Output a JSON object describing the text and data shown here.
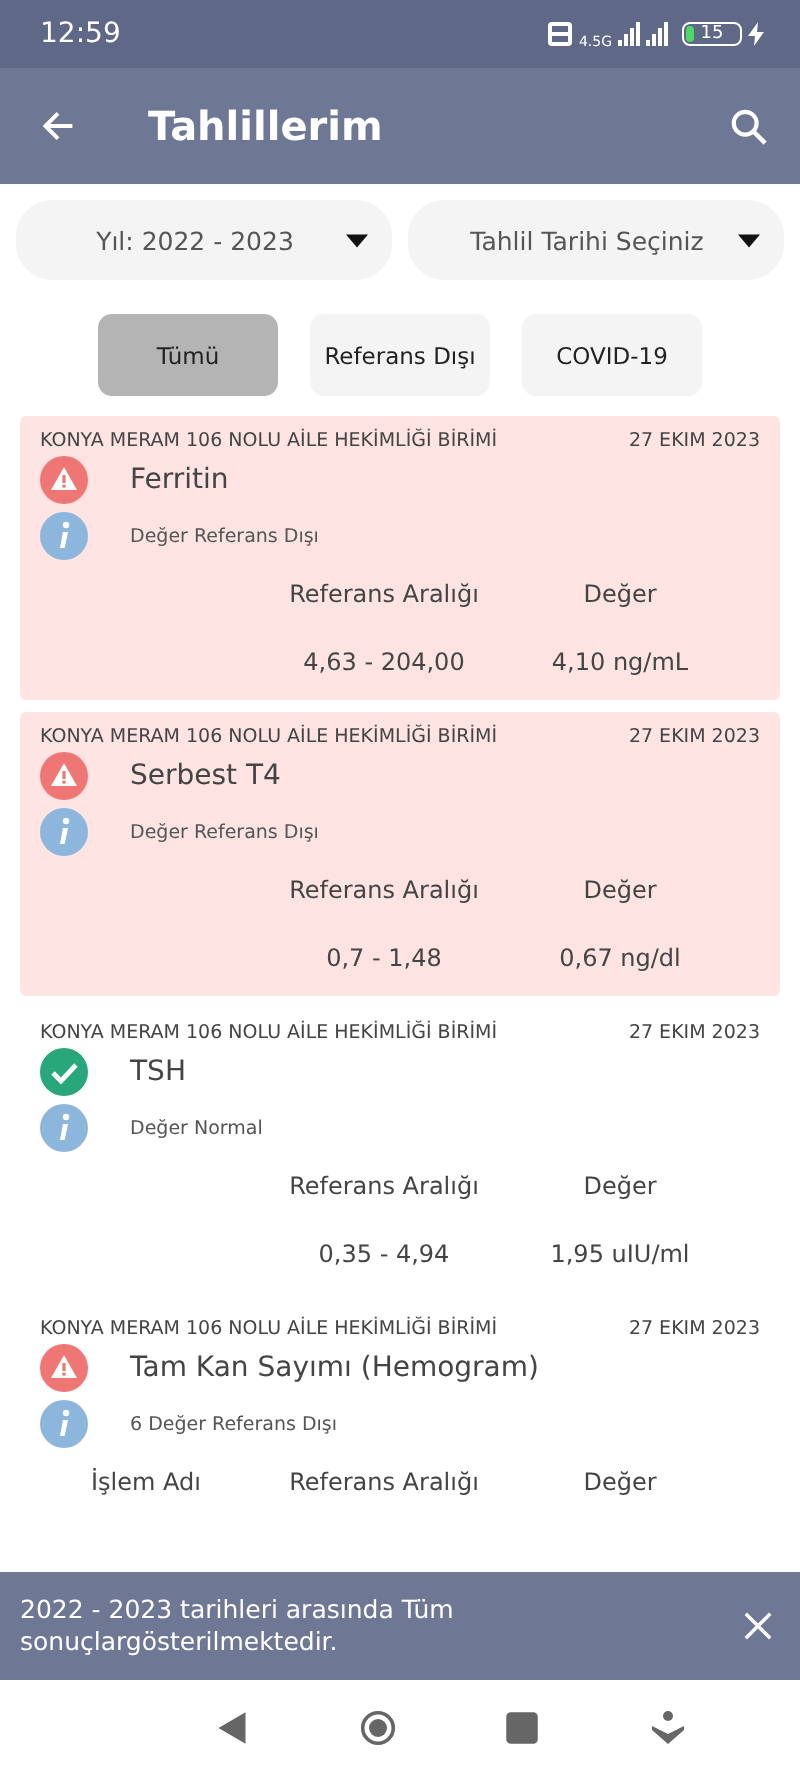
{
  "status_bar": {
    "time": "12:59",
    "network": "4.5G",
    "battery": "15"
  },
  "app_bar": {
    "title": "Tahlillerim"
  },
  "dropdowns": [
    {
      "value": "Yıl: 2022 - 2023"
    },
    {
      "value": "Tahlil Tarihi Seçiniz"
    }
  ],
  "filters": [
    {
      "label": "Tümü",
      "selected": true
    },
    {
      "label": "Referans Dışı",
      "selected": false
    },
    {
      "label": "COVID-19",
      "selected": false
    }
  ],
  "results": [
    {
      "kind": "abnormal",
      "institution": "KONYA MERAM 106 NOLU AİLE HEKİMLİĞİ BİRİMİ",
      "date": "27 EKIM 2023",
      "name": "Ferritin",
      "note": "Değer Referans Dışı",
      "columns": [
        "Referans Aralığı",
        "Değer"
      ],
      "values": [
        "4,63 - 204,00",
        "4,10 ng/mL"
      ]
    },
    {
      "kind": "abnormal",
      "institution": "KONYA MERAM 106 NOLU AİLE HEKİMLİĞİ BİRİMİ",
      "date": "27 EKIM 2023",
      "name": "Serbest T4",
      "note": "Değer Referans Dışı",
      "columns": [
        "Referans Aralığı",
        "Değer"
      ],
      "values": [
        "0,7 - 1,48",
        "0,67 ng/dl"
      ]
    },
    {
      "kind": "normal",
      "institution": "KONYA MERAM 106 NOLU AİLE HEKİMLİĞİ BİRİMİ",
      "date": "27 EKIM 2023",
      "name": "TSH",
      "note": "Değer Normal",
      "columns": [
        "Referans Aralığı",
        "Değer"
      ],
      "values": [
        "0,35 - 4,94",
        "1,95 uIU/ml"
      ]
    },
    {
      "kind": "abnormal_group",
      "institution": "KONYA MERAM 106 NOLU AİLE HEKİMLİĞİ BİRİMİ",
      "date": "27 EKIM 2023",
      "name": "Tam Kan Sayımı (Hemogram)",
      "note": "6 Değer Referans Dışı",
      "columns": [
        "İşlem Adı",
        "Referans Aralığı",
        "Değer"
      ]
    }
  ],
  "snackbar": {
    "message": "2022 - 2023 tarihleri arasında Tüm sonuçlargösterilmektedir."
  }
}
